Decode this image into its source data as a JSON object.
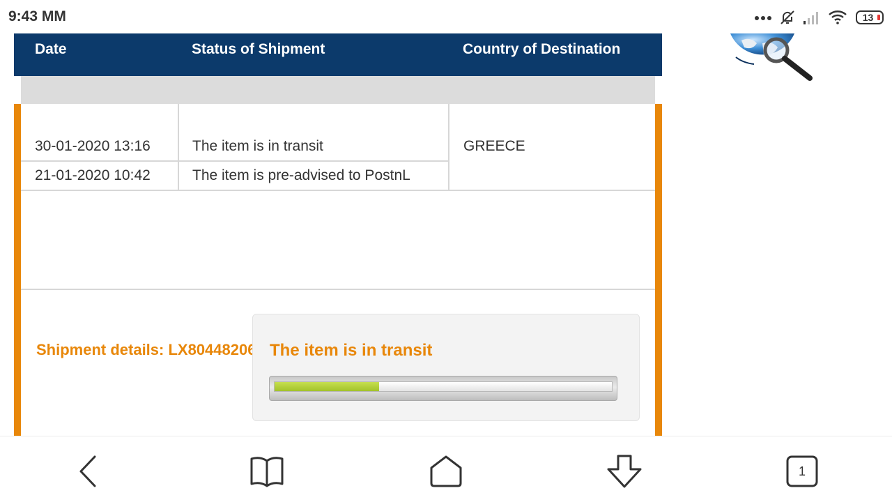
{
  "status_bar": {
    "time": "9:43 MM",
    "battery": "13",
    "icons": [
      "more-dots-icon",
      "bell-muted-icon",
      "signal-icon",
      "wifi-icon",
      "battery-icon"
    ]
  },
  "table": {
    "headers": [
      "Date",
      "Status of Shipment",
      "Country of Destination"
    ],
    "rows": [
      {
        "date": "30-01-2020 13:16",
        "status": "The item is in transit"
      },
      {
        "date": "21-01-2020 10:42",
        "status": "The item is pre-advised to PostnL"
      }
    ],
    "country": "GREECE"
  },
  "details": {
    "label": "Shipment details: LX80448206"
  },
  "status_box": {
    "title": "The item is in transit",
    "progress": 0.31
  },
  "nav": {
    "items": [
      "back-icon",
      "bookmarks-icon",
      "home-icon",
      "download-icon",
      "tabs-icon"
    ],
    "tab_count": "1"
  },
  "colors": {
    "header_bg": "#0c3a6b",
    "accent": "#e8870a",
    "progress": "#a9c832"
  }
}
